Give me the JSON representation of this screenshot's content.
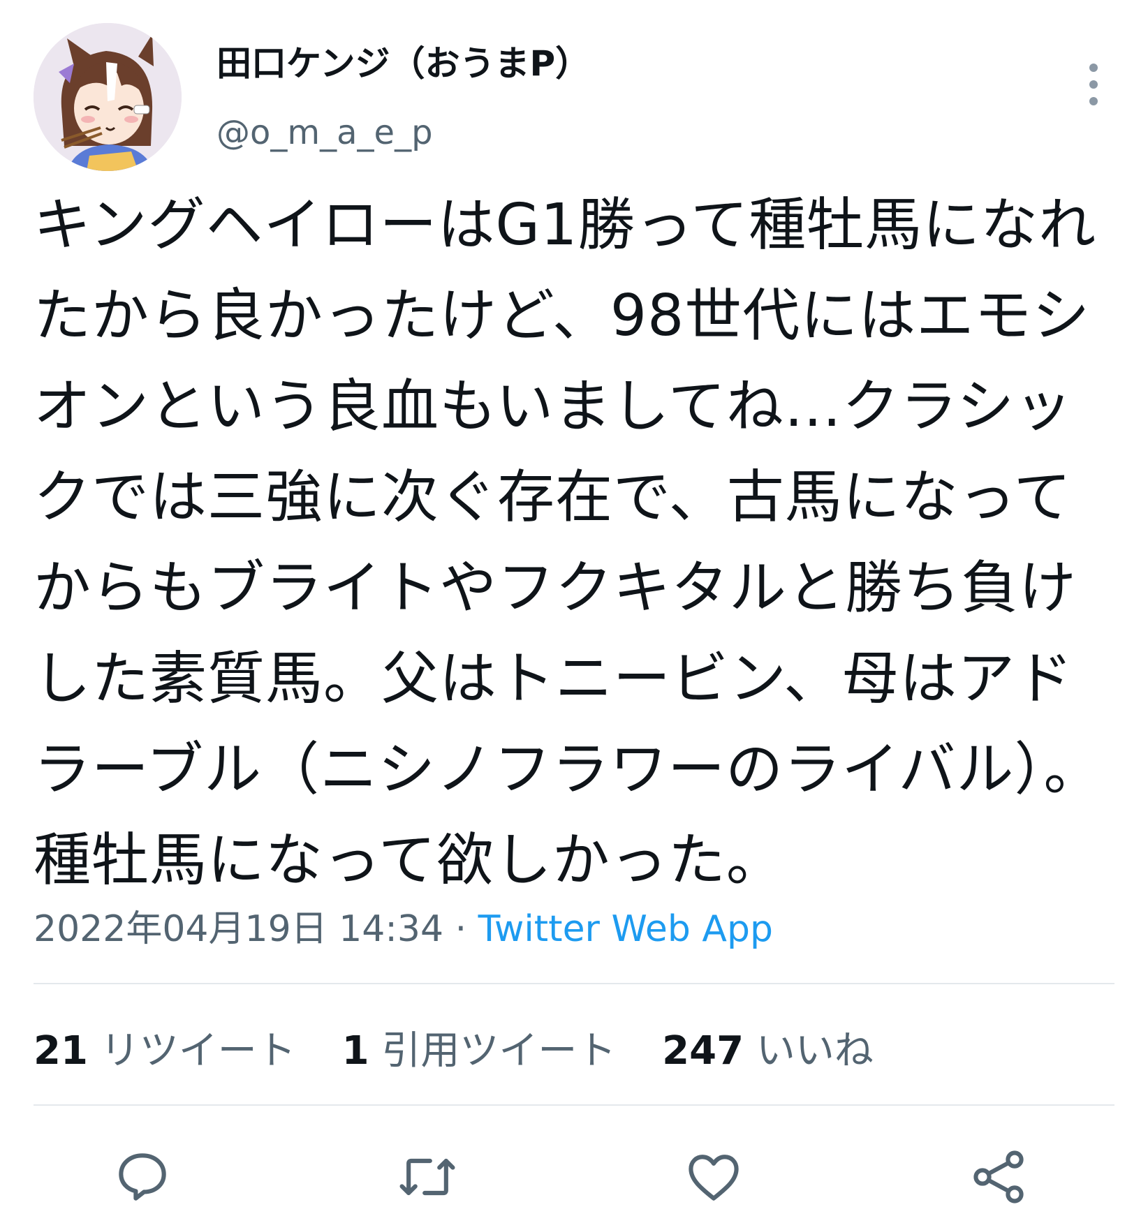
{
  "author": {
    "display_name": "田口ケンジ（おうまP）",
    "handle": "@o_m_a_e_p",
    "avatar_icon": "anime-character-avatar"
  },
  "tweet": {
    "text": "キングヘイローはG1勝って種牡馬になれたから良かったけど、98世代にはエモシオンという良血もいましてね…クラシックでは三強に次ぐ存在で、古馬になってからもブライトやフクキタルと勝ち負けした素質馬。父はトニービン、母はアドラーブル（ニシノフラワーのライバル）。種牡馬になって欲しかった。",
    "timestamp": "2022年04月19日 14:34",
    "separator": " · ",
    "source": "Twitter Web App"
  },
  "stats": {
    "retweets_count": "21",
    "retweets_label": "リツイート",
    "quotes_count": "1",
    "quotes_label": "引用ツイート",
    "likes_count": "247",
    "likes_label": "いいね"
  },
  "actions": {
    "reply_icon": "reply-bubble-icon",
    "retweet_icon": "retweet-icon",
    "like_icon": "heart-icon",
    "share_icon": "share-icon"
  },
  "colors": {
    "text": "#0f1419",
    "secondary": "#536471",
    "link": "#1d9bf0",
    "divider": "#e4e8ec",
    "icon": "#536471"
  }
}
